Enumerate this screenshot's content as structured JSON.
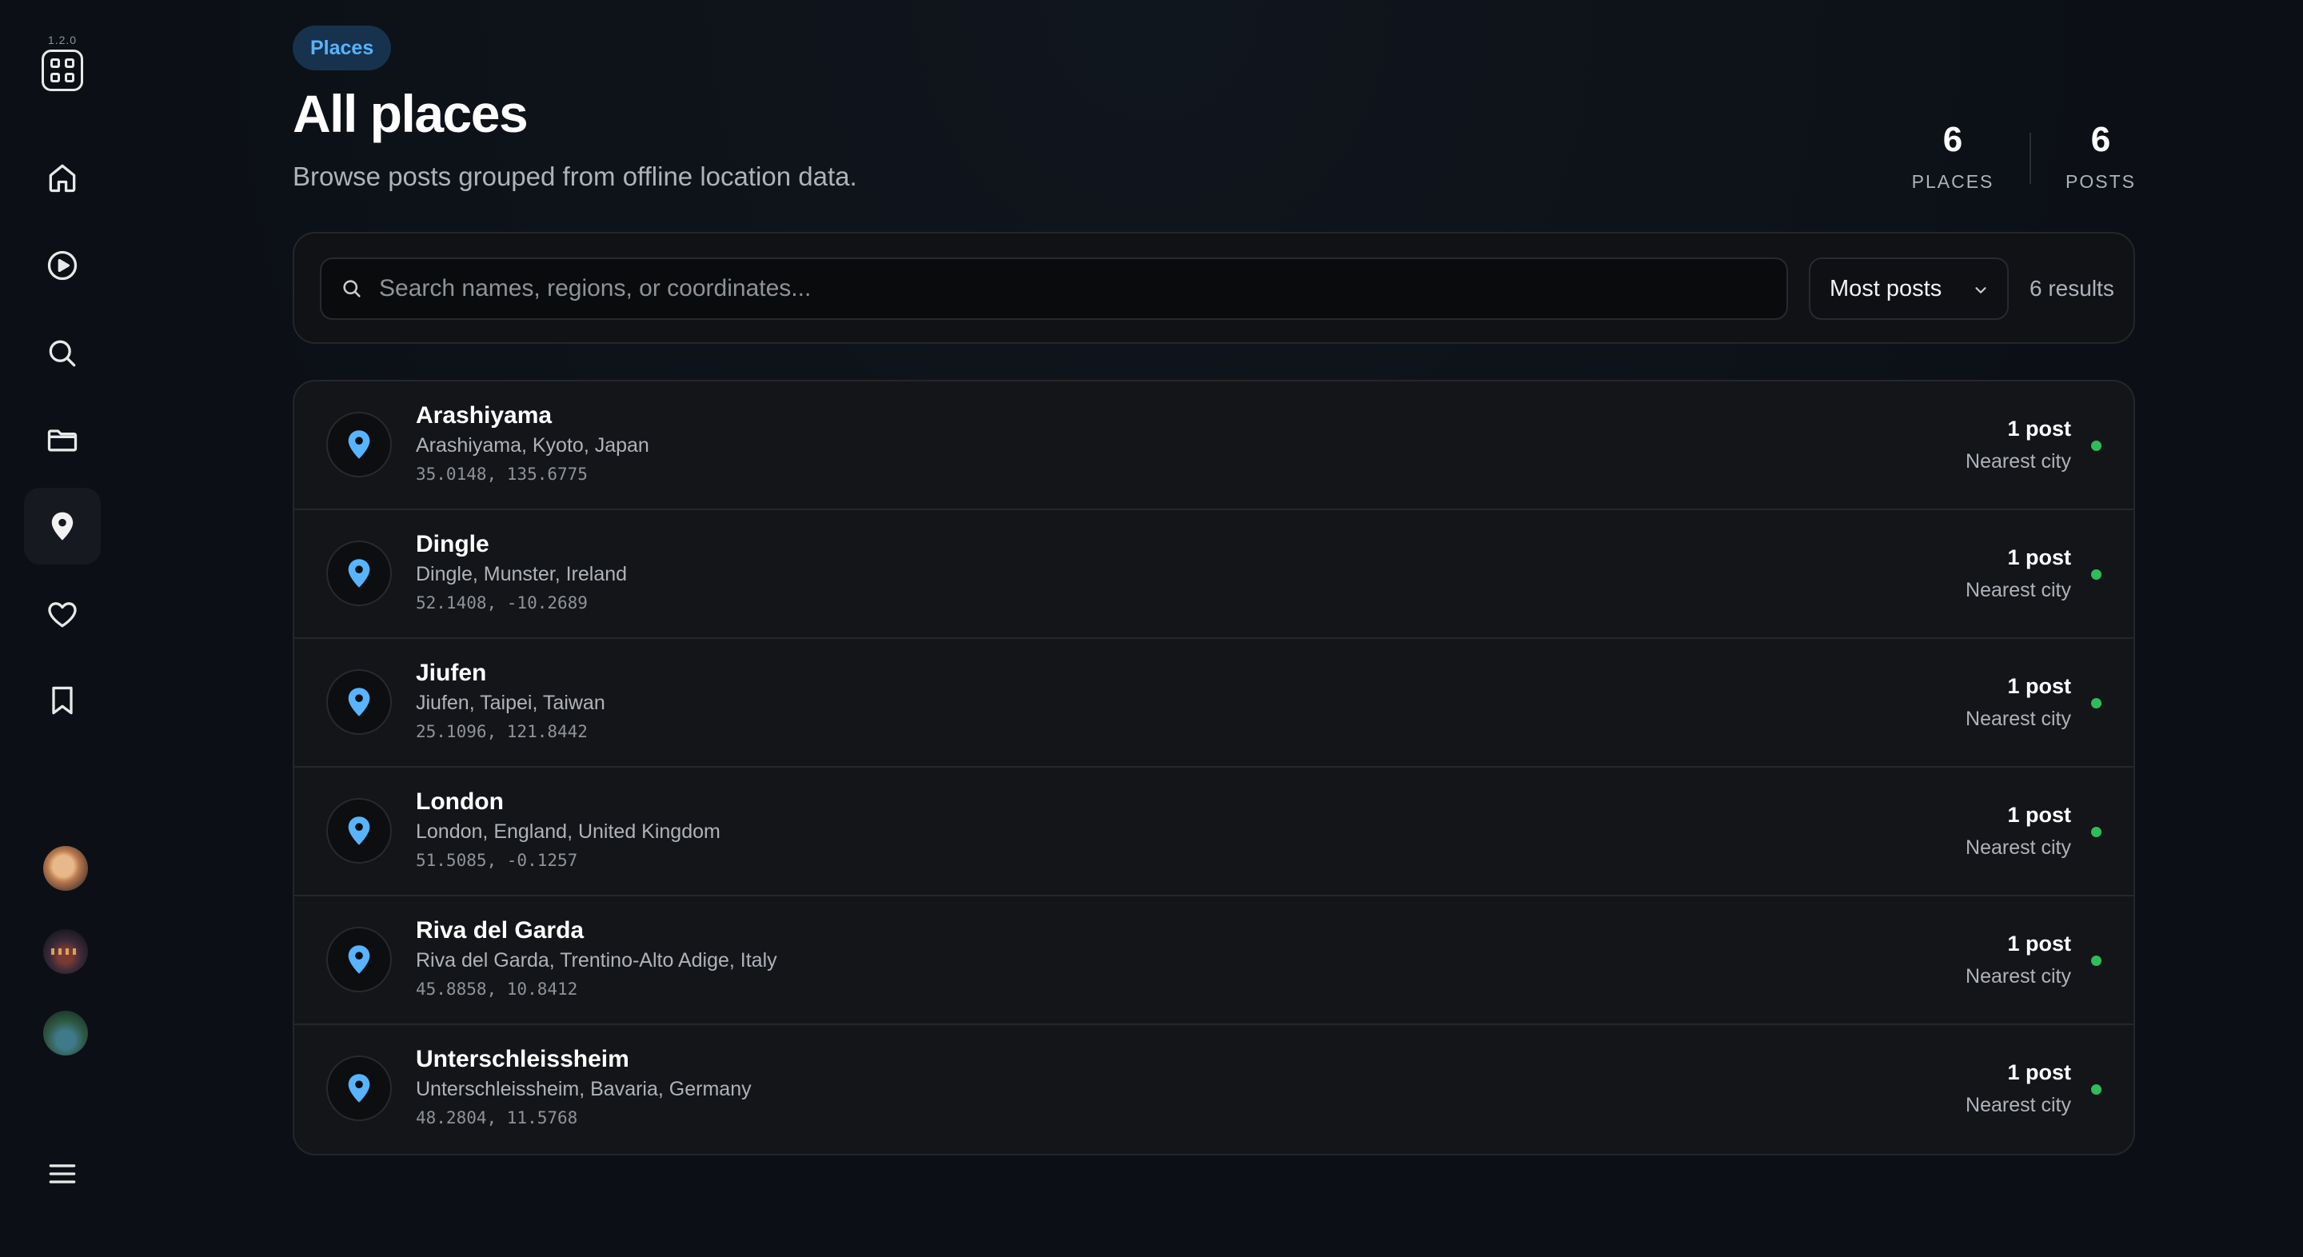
{
  "app": {
    "version": "1.2.0"
  },
  "sidebar": {
    "nav": [
      {
        "name": "home",
        "icon": "home-icon"
      },
      {
        "name": "play",
        "icon": "play-circle-icon"
      },
      {
        "name": "search",
        "icon": "search-icon"
      },
      {
        "name": "folder",
        "icon": "folder-icon"
      },
      {
        "name": "places",
        "icon": "map-pin-icon",
        "active": true
      },
      {
        "name": "favorites",
        "icon": "heart-icon"
      },
      {
        "name": "bookmarks",
        "icon": "bookmark-icon"
      }
    ],
    "menu_icon": "menu-icon"
  },
  "header": {
    "chip": "Places",
    "title": "All places",
    "subtitle": "Browse posts grouped from offline location data."
  },
  "stats": {
    "places": {
      "value": "6",
      "label": "PLACES"
    },
    "posts": {
      "value": "6",
      "label": "POSTS"
    }
  },
  "search": {
    "placeholder": "Search names, regions, or coordinates...",
    "value": ""
  },
  "sort": {
    "selected": "Most posts"
  },
  "results": {
    "count_label": "6 results"
  },
  "places": [
    {
      "name": "Arashiyama",
      "region": "Arashiyama, Kyoto, Japan",
      "coords": "35.0148, 135.6775",
      "count": "1 post",
      "meta": "Nearest city"
    },
    {
      "name": "Dingle",
      "region": "Dingle, Munster, Ireland",
      "coords": "52.1408, -10.2689",
      "count": "1 post",
      "meta": "Nearest city"
    },
    {
      "name": "Jiufen",
      "region": "Jiufen, Taipei, Taiwan",
      "coords": "25.1096, 121.8442",
      "count": "1 post",
      "meta": "Nearest city"
    },
    {
      "name": "London",
      "region": "London, England, United Kingdom",
      "coords": "51.5085, -0.1257",
      "count": "1 post",
      "meta": "Nearest city"
    },
    {
      "name": "Riva del Garda",
      "region": "Riva del Garda, Trentino-Alto Adige, Italy",
      "coords": "45.8858, 10.8412",
      "count": "1 post",
      "meta": "Nearest city"
    },
    {
      "name": "Unterschleissheim",
      "region": "Unterschleissheim, Bavaria, Germany",
      "coords": "48.2804, 11.5768",
      "count": "1 post",
      "meta": "Nearest city"
    }
  ],
  "colors": {
    "accent": "#58b4ff",
    "chip_bg": "#16324d",
    "status_green": "#2ebd59",
    "background": "#0c1016"
  }
}
